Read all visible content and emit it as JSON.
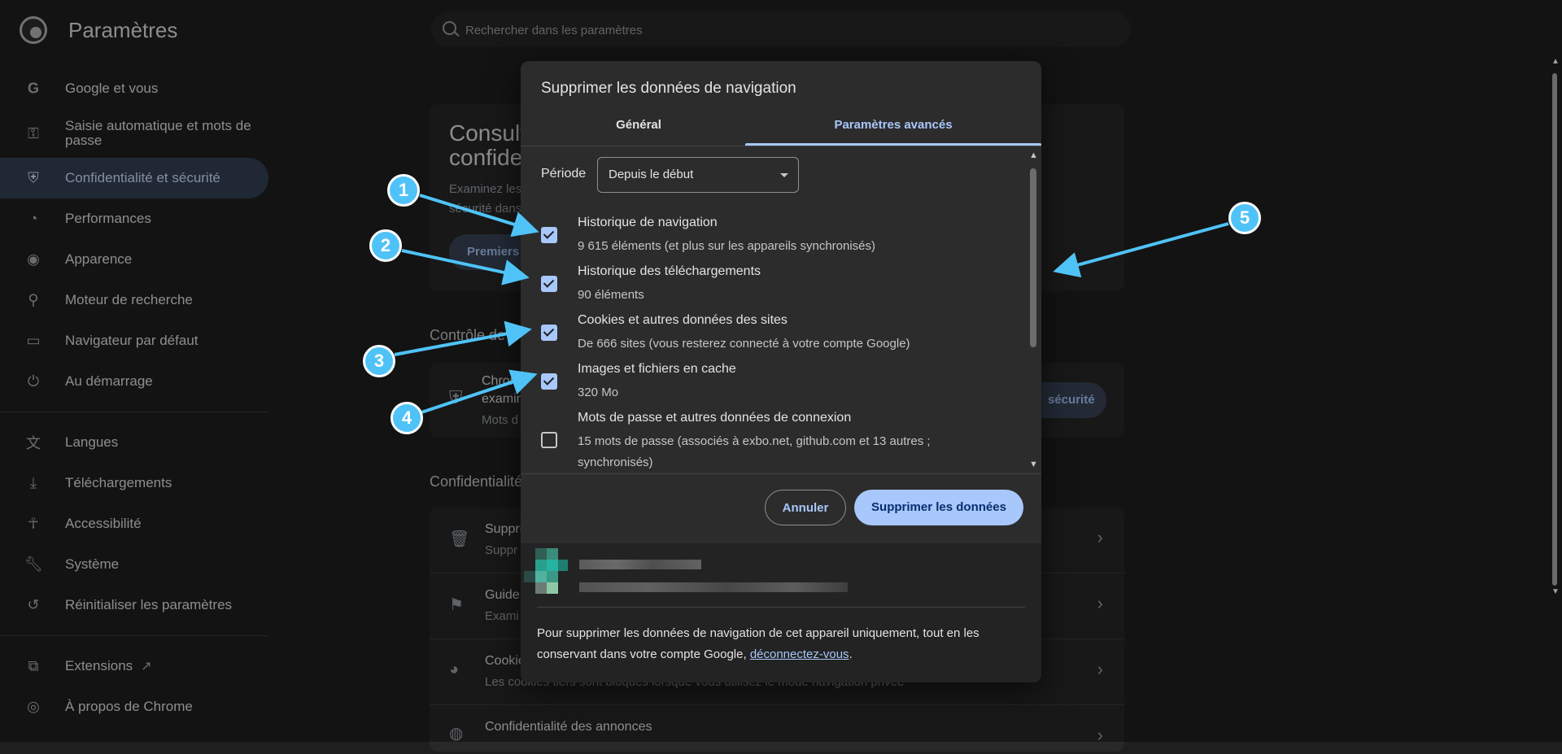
{
  "app": {
    "title": "Paramètres"
  },
  "search": {
    "placeholder": "Rechercher dans les paramètres"
  },
  "sidebar": {
    "items": [
      {
        "label": "Google et vous",
        "icon": "google-icon"
      },
      {
        "label": "Saisie automatique et mots de passe",
        "icon": "key-icon"
      },
      {
        "label": "Confidentialité et sécurité",
        "icon": "shield-icon",
        "active": true
      },
      {
        "label": "Performances",
        "icon": "speedometer-icon"
      },
      {
        "label": "Apparence",
        "icon": "palette-icon"
      },
      {
        "label": "Moteur de recherche",
        "icon": "search-icon"
      },
      {
        "label": "Navigateur par défaut",
        "icon": "browser-icon"
      },
      {
        "label": "Au démarrage",
        "icon": "power-icon"
      },
      {
        "label": "Langues",
        "icon": "translate-icon"
      },
      {
        "label": "Téléchargements",
        "icon": "download-icon"
      },
      {
        "label": "Accessibilité",
        "icon": "accessibility-icon"
      },
      {
        "label": "Système",
        "icon": "wrench-icon"
      },
      {
        "label": "Réinitialiser les paramètres",
        "icon": "reset-icon"
      },
      {
        "label": "Extensions",
        "icon": "puzzle-icon"
      },
      {
        "label": "À propos de Chrome",
        "icon": "chrome-icon"
      }
    ]
  },
  "background": {
    "card_title_1": "Consult",
    "card_title_2": "confide",
    "card_text_1": "Examinez les",
    "card_text_2": "sécurité dans",
    "card_button": "Premiers",
    "section_1": "Contrôle de",
    "row1_title": "Chrom",
    "row1_sub": "examin",
    "row1_muted": "Mots d",
    "row1_button": "sécurité",
    "section_2": "Confidentialité",
    "list": [
      {
        "title": "Suppri",
        "sub": "Suppr"
      },
      {
        "title": "Guide",
        "sub": "Exami"
      },
      {
        "title": "Cookie",
        "sub": "Les cookies tiers sont bloqués lorsque vous utilisez le mode navigation privée"
      },
      {
        "title": "Confidentialité des annonces",
        "sub": ""
      }
    ]
  },
  "dialog": {
    "title": "Supprimer les données de navigation",
    "tabs": {
      "general": "Général",
      "advanced": "Paramètres avancés"
    },
    "period": {
      "label": "Période",
      "value": "Depuis le début"
    },
    "options": [
      {
        "title": "Historique de navigation",
        "sub": "9 615 éléments (et plus sur les appareils synchronisés)",
        "checked": true
      },
      {
        "title": "Historique des téléchargements",
        "sub": "90 éléments",
        "checked": true
      },
      {
        "title": "Cookies et autres données des sites",
        "sub": "De 666 sites (vous resterez connecté à votre compte Google)",
        "checked": true
      },
      {
        "title": "Images et fichiers en cache",
        "sub": "320 Mo",
        "checked": true
      },
      {
        "title": "Mots de passe et autres données de connexion",
        "sub": "15 mots de passe (associés à exbo.net, github.com et 13 autres ; synchronisés)",
        "checked": false
      }
    ],
    "buttons": {
      "cancel": "Annuler",
      "delete": "Supprimer les données"
    },
    "note_text": "Pour supprimer les données de navigation de cet appareil uniquement, tout en les conservant dans votre compte Google, ",
    "note_link": "déconnectez-vous",
    "note_end": "."
  },
  "markers": [
    "1",
    "2",
    "3",
    "4",
    "5"
  ],
  "colors": {
    "accent": "#a8c7fa",
    "marker": "#4fc3f7",
    "active_nav": "#344156",
    "background": "#1f1f1f"
  }
}
